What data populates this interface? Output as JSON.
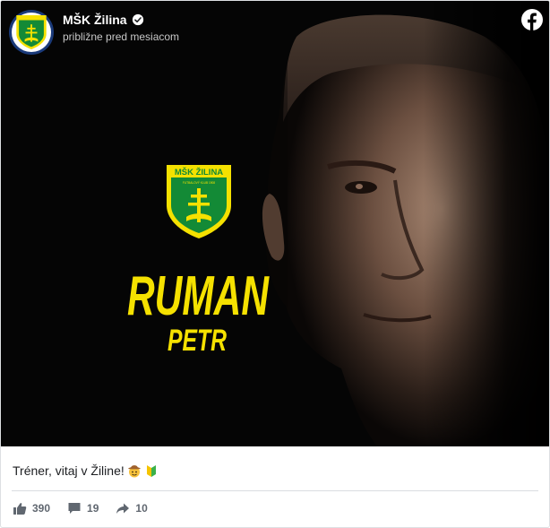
{
  "header": {
    "page_name": "MŠK Žilina",
    "timestamp": "približne pred mesiacom"
  },
  "media": {
    "crest_title": "MŠK ŽILINA",
    "crest_subtitle": "FUTBALOVÝ KLUB 1908",
    "surname": "RUMAN",
    "first_name": "PETR"
  },
  "post": {
    "caption": "Tréner, vitaj v Žiline!"
  },
  "stats": {
    "likes": "390",
    "comments": "19",
    "shares": "10"
  },
  "colors": {
    "club_yellow": "#f5e100",
    "club_green": "#138a36",
    "facebook_blue": "#1877f2",
    "text_secondary": "#606770"
  },
  "icons": {
    "verified": "verified-badge-icon",
    "facebook": "facebook-logo-icon",
    "like": "thumbs-up-icon",
    "comment": "comment-bubble-icon",
    "share": "share-arrow-icon",
    "emoji_1": "cowboy-face-emoji",
    "emoji_2": "japanese-beginner-symbol-emoji"
  }
}
